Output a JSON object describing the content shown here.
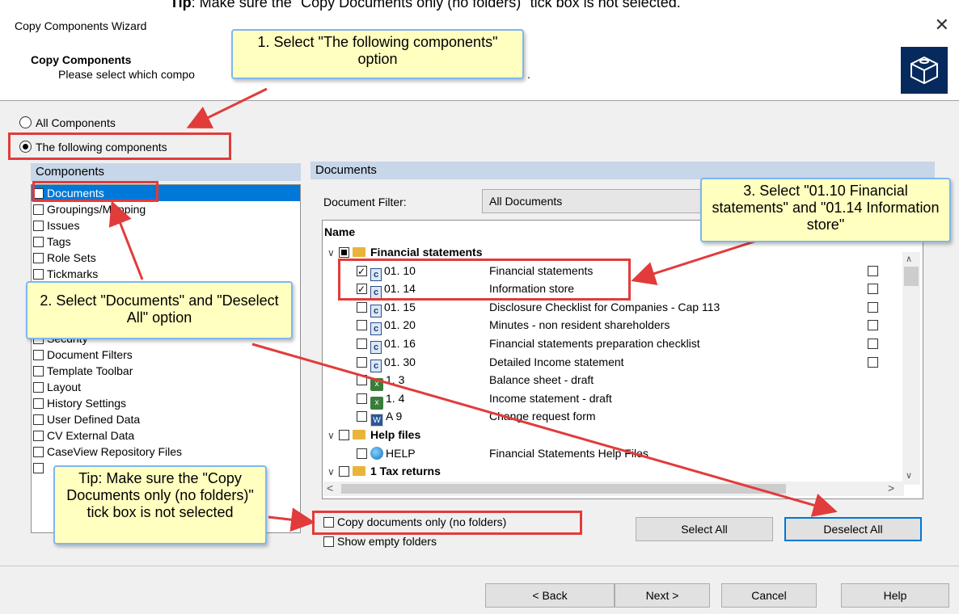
{
  "top_note": {
    "bold": "Tip",
    "text": ": Make sure the \"Copy Documents only (no folders)\" tick box is not selected."
  },
  "window": {
    "title": "Copy Components Wizard",
    "close_glyph": "✕"
  },
  "header": {
    "title": "Copy Components",
    "subtitle": "Please select which compo",
    "subtitle_tail": "."
  },
  "options": {
    "all": "All Components",
    "following": "The following components"
  },
  "components": {
    "header": "Components",
    "items": [
      {
        "label": "Documents",
        "checked": true,
        "selected": true
      },
      {
        "label": "Groupings/Mapping",
        "checked": false
      },
      {
        "label": "Issues",
        "checked": false
      },
      {
        "label": "Tags",
        "checked": false
      },
      {
        "label": "Role Sets",
        "checked": false
      },
      {
        "label": "Tickmarks",
        "checked": false
      },
      {
        "label": "",
        "checked": false
      },
      {
        "label": "",
        "checked": false
      },
      {
        "label": "",
        "checked": false
      },
      {
        "label": "Security",
        "checked": false
      },
      {
        "label": "Document Filters",
        "checked": false
      },
      {
        "label": "Template Toolbar",
        "checked": false
      },
      {
        "label": "Layout",
        "checked": false
      },
      {
        "label": "History Settings",
        "checked": false
      },
      {
        "label": "User Defined Data",
        "checked": false
      },
      {
        "label": "CV External Data",
        "checked": false
      },
      {
        "label": "CaseView Repository Files",
        "checked": false
      },
      {
        "label": "",
        "checked": false
      }
    ]
  },
  "documents": {
    "header": "Documents",
    "filter_label": "Document Filter:",
    "filter_value": "All Documents",
    "name_col": "Name",
    "rows": [
      {
        "kind": "folder",
        "code": "Financial statements",
        "desc": "",
        "checked": "partial"
      },
      {
        "kind": "c",
        "code": "01. 10",
        "desc": "Financial statements",
        "checked": "on",
        "right": true
      },
      {
        "kind": "c",
        "code": "01. 14",
        "desc": "Information store",
        "checked": "on",
        "right": true
      },
      {
        "kind": "c",
        "code": "01. 15",
        "desc": "Disclosure Checklist for Companies - Cap 113",
        "checked": "off",
        "right": true
      },
      {
        "kind": "c",
        "code": "01. 20",
        "desc": "Minutes - non resident shareholders",
        "checked": "off",
        "right": true
      },
      {
        "kind": "c",
        "code": "01. 16",
        "desc": "Financial statements preparation checklist",
        "checked": "off",
        "right": true
      },
      {
        "kind": "c",
        "code": "01. 30",
        "desc": "Detailed Income statement",
        "checked": "off",
        "right": true
      },
      {
        "kind": "x",
        "code": "1. 3",
        "desc": "Balance sheet - draft",
        "checked": "off"
      },
      {
        "kind": "x",
        "code": "1. 4",
        "desc": "Income statement - draft",
        "checked": "off"
      },
      {
        "kind": "w",
        "code": "A 9",
        "desc": "Change request form",
        "checked": "off"
      },
      {
        "kind": "folder",
        "code": "Help files",
        "desc": "",
        "checked": "off"
      },
      {
        "kind": "g",
        "code": "HELP",
        "desc": "Financial Statements Help Files",
        "checked": "off"
      },
      {
        "kind": "folder",
        "code": "1 Tax returns",
        "desc": "",
        "checked": "off"
      }
    ],
    "copy_docs_only": "Copy documents only (no folders)",
    "show_empty": "Show empty folders",
    "select_all": "Select All",
    "deselect_all": "Deselect All"
  },
  "footer": {
    "back": "< Back",
    "next": "Next >",
    "cancel": "Cancel",
    "help": "Help"
  },
  "callouts": {
    "c1": "1. Select \"The following components\" option",
    "c2": "2. Select \"Documents\" and \"Deselect All\" option",
    "c3": "3. Select \"01.10 Financial statements\" and \"01.14 Information store\"",
    "tip": "Tip: Make sure the \"Copy Documents only (no folders)\" tick box is not selected"
  },
  "colors": {
    "accent": "#0078d7",
    "callout_bg": "#ffffc0",
    "callout_border": "#7fb6ef",
    "annotation_red": "#e23b3b",
    "panel_header": "#c7d6e8"
  }
}
